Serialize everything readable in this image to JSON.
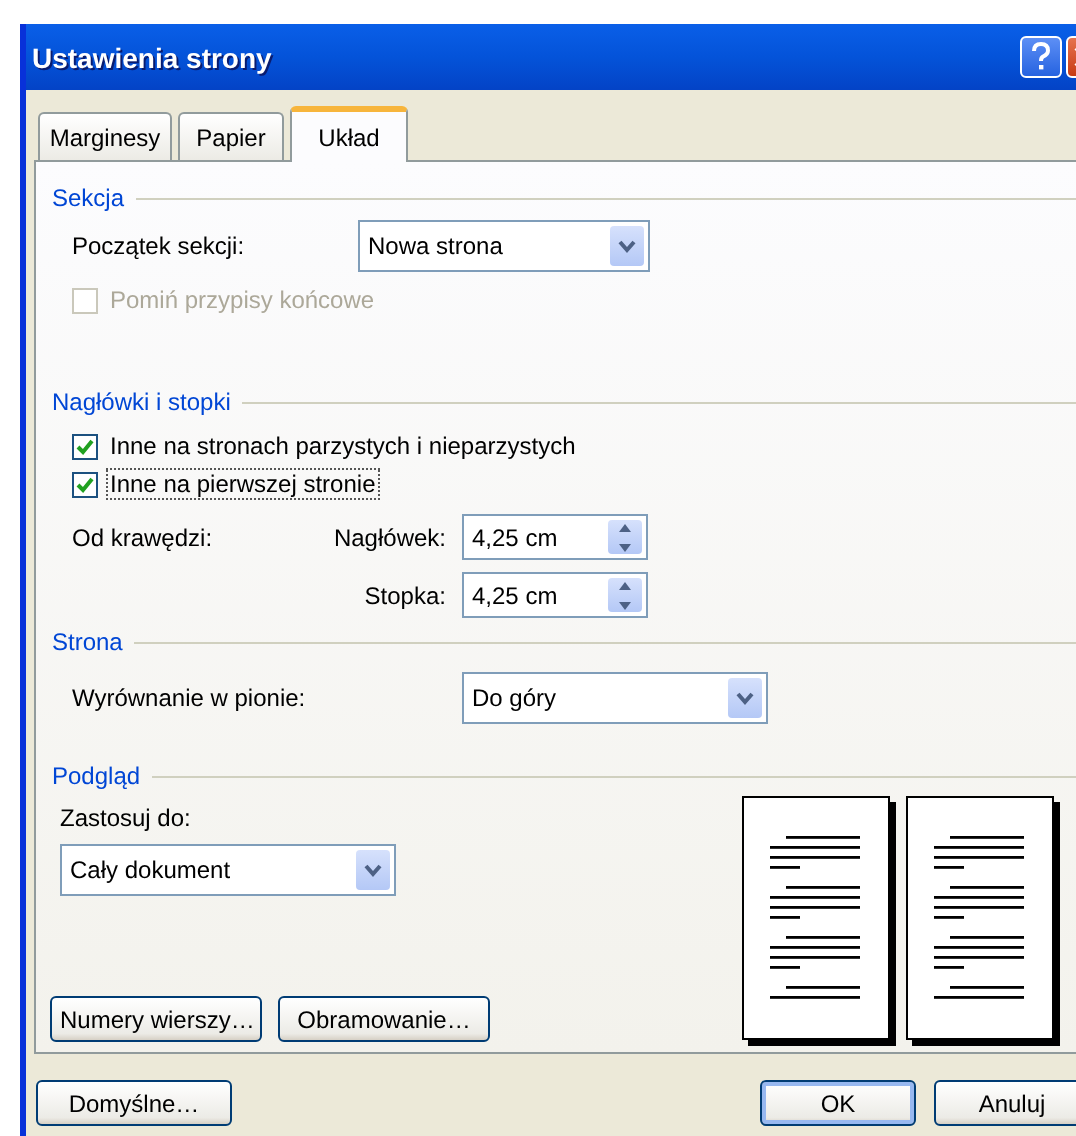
{
  "window": {
    "title": "Ustawienia strony"
  },
  "tabs": [
    {
      "label": "Marginesy",
      "selected": false
    },
    {
      "label": "Papier",
      "selected": false
    },
    {
      "label": "Układ",
      "selected": true
    }
  ],
  "section": {
    "heading": "Sekcja",
    "start_label": "Początek sekcji:",
    "start_value": "Nowa strona",
    "endnotes": {
      "label": "Pomiń przypisy końcowe",
      "checked": false,
      "disabled": true
    }
  },
  "headers_footers": {
    "heading": "Nagłówki i stopki",
    "options": [
      {
        "label": "Inne na stronach parzystych i nieparzystych",
        "checked": true,
        "focused": false
      },
      {
        "label": "Inne na pierwszej stronie",
        "checked": true,
        "focused": true
      }
    ],
    "from_edge_label": "Od krawędzi:",
    "spins": [
      {
        "label": "Nagłówek:",
        "value": "4,25 cm"
      },
      {
        "label": "Stopka:",
        "value": "4,25 cm"
      }
    ]
  },
  "page": {
    "heading": "Strona",
    "valign_label": "Wyrównanie w pionie:",
    "valign_value": "Do góry"
  },
  "preview": {
    "heading": "Podgląd",
    "apply_label": "Zastosuj do:",
    "apply_value": "Cały dokument",
    "buttons": [
      "Numery wierszy…",
      "Obramowanie…"
    ]
  },
  "footer_buttons": [
    {
      "label": "Domyślne…",
      "default": false
    },
    {
      "label": "OK",
      "default": true
    },
    {
      "label": "Anuluj",
      "default": false
    }
  ]
}
